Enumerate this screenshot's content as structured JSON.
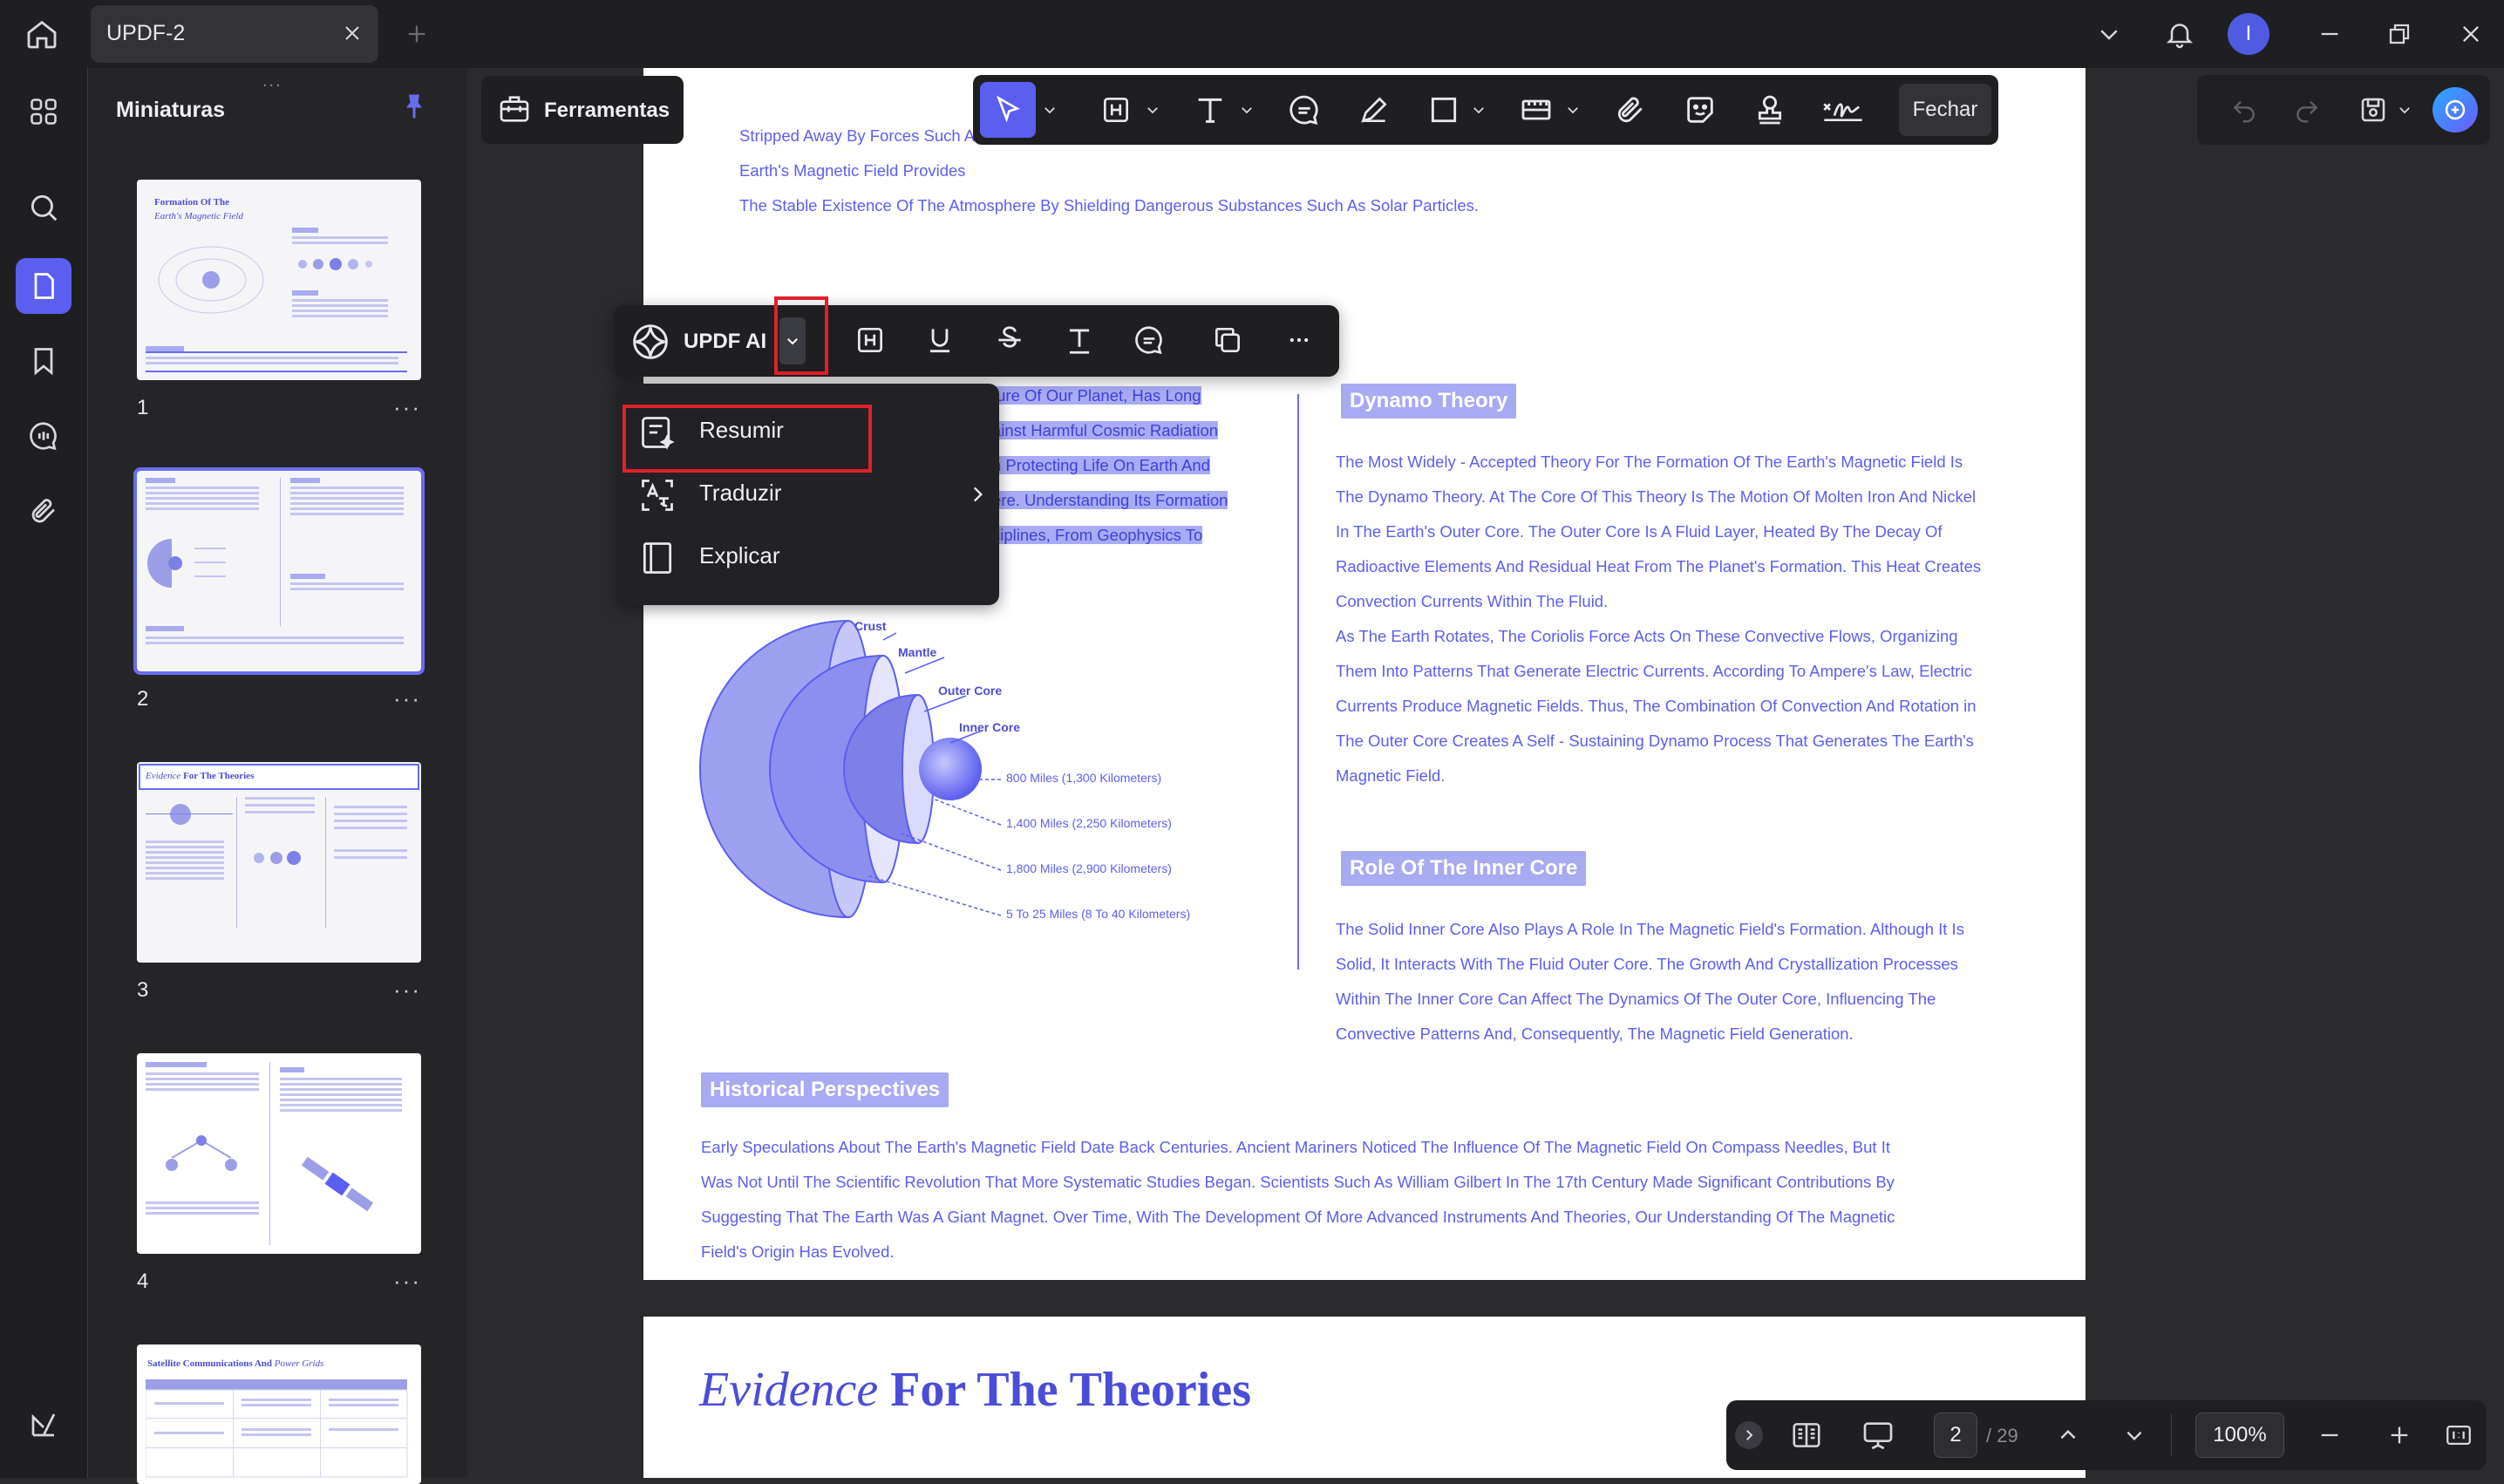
{
  "tab": {
    "title": "UPDF-2"
  },
  "sidebar": {
    "title": "Miniaturas"
  },
  "thumbnails": [
    {
      "number": "1",
      "title_a": "Formation Of The",
      "title_b": "Earth's Magnetic Field"
    },
    {
      "number": "2"
    },
    {
      "number": "3",
      "title_a": "Evidence",
      "title_b": "For The Theories"
    },
    {
      "number": "4"
    },
    {
      "number": "",
      "title_a": "Satellite Communications And",
      "title_b": "Power Grids"
    }
  ],
  "toolbar": {
    "tools_label": "Ferramentas",
    "close_label": "Fechar"
  },
  "ai_toolbar": {
    "label": "UPDF AI"
  },
  "ai_menu": [
    {
      "label": "Resumir"
    },
    {
      "label": "Traduzir"
    },
    {
      "label": "Explicar"
    }
  ],
  "page1": {
    "lines": [
      "Stripped Away By Forces Such A",
      "Earth's Magnetic Field Provides",
      "The Stable Existence Of The Atmosphere By Shielding Dangerous Substances Such As Solar Particles."
    ]
  },
  "page2": {
    "left_lines": [
      "ture Of Our Planet, Has Long",
      "ainst Harmful Cosmic Radiation",
      "n Protecting Life On Earth And",
      "ere. Understanding Its Formation",
      "ciplines, From Geophysics To"
    ],
    "diagram": {
      "labels": [
        "Crust",
        "Mantle",
        "Outer Core",
        "Inner Core"
      ],
      "depths": [
        "800 Miles (1,300 Kilometers)",
        "1,400 Miles (2,250 Kilometers)",
        "1,800 Miles (2,900 Kilometers)",
        "5 To 25 Miles (8 To 40 Kilometers)"
      ]
    },
    "dynamo": {
      "heading": "Dynamo Theory",
      "lines": [
        "The Most Widely - Accepted Theory For The Formation Of The Earth's Magnetic Field Is",
        "The Dynamo Theory. At The Core Of This Theory Is The Motion Of Molten Iron And Nickel",
        "In The Earth's Outer Core. The Outer Core Is A Fluid Layer, Heated By The Decay Of",
        "Radioactive Elements And Residual Heat From The Planet's Formation. This Heat Creates",
        "Convection Currents Within The Fluid.",
        "As The Earth Rotates, The Coriolis Force Acts On These Convective Flows, Organizing",
        "Them Into Patterns That Generate Electric Currents. According To Ampere's Law, Electric",
        "Currents Produce Magnetic Fields. Thus, The Combination Of Convection And Rotation in",
        "The Outer Core Creates A Self - Sustaining Dynamo Process That Generates The Earth's",
        "Magnetic Field."
      ]
    },
    "inner_core": {
      "heading": "Role Of The Inner Core",
      "lines": [
        "The Solid Inner Core Also Plays A Role In The Magnetic Field's Formation. Although It Is",
        "Solid, It Interacts With The Fluid Outer Core. The Growth And Crystallization Processes",
        "Within The Inner Core Can Affect The Dynamics Of The Outer Core, Influencing The",
        "Convective Patterns And, Consequently, The Magnetic Field Generation."
      ]
    },
    "historical": {
      "heading": "Historical Perspectives",
      "lines": [
        "Early Speculations About The Earth's Magnetic Field Date Back Centuries. Ancient Mariners Noticed The Influence Of The Magnetic Field On Compass Needles, But It",
        "Was Not Until The Scientific Revolution That More Systematic Studies Began. Scientists Such As William Gilbert In The 17th Century Made Significant Contributions By",
        "Suggesting That The Earth Was A Giant Magnet. Over Time, With The Development Of More Advanced Instruments And Theories, Our Understanding Of The Magnetic",
        "Field's Origin Has Evolved."
      ]
    }
  },
  "page3": {
    "title_italic": "Evidence",
    "title_bold": "For The Theories"
  },
  "user": {
    "initial": "I"
  },
  "bottom": {
    "page_current": "2",
    "page_total": "/ 29",
    "zoom": "100%"
  },
  "colors": {
    "accent": "#5b5ff0",
    "highlight": "#a9abf5",
    "red_box": "#e0202a"
  }
}
